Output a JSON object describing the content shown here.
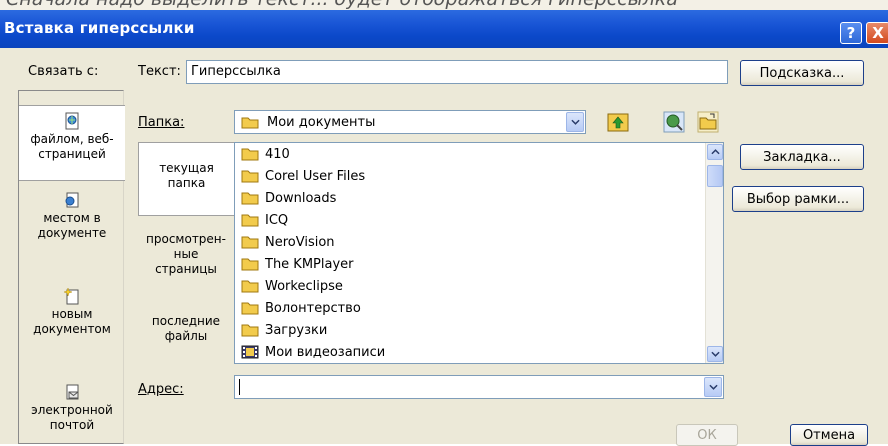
{
  "background_caption": "Сначала надо выделить текст... будет отображаться гиперссылка",
  "window": {
    "title": "Вставка гиперссылки",
    "help_label": "?",
    "close_label": "X"
  },
  "link_to": {
    "label": "Связать с:",
    "items": [
      {
        "label": "файлом, веб-страницей",
        "icon": "web-page-icon",
        "selected": true
      },
      {
        "label": "местом в документе",
        "icon": "place-in-document-icon",
        "selected": false
      },
      {
        "label": "новым документом",
        "icon": "new-document-icon",
        "selected": false
      },
      {
        "label": "электронной почтой",
        "icon": "email-icon",
        "selected": false
      }
    ]
  },
  "text_field": {
    "label": "Текст:",
    "value": "Гиперссылка"
  },
  "tooltip_button": "Подсказка...",
  "folder": {
    "label": "Папка:",
    "value": "Мои документы"
  },
  "places": [
    {
      "label": "текущая папка",
      "selected": true
    },
    {
      "label": "просмотрен-ные страницы",
      "selected": false
    },
    {
      "label": "последние файлы",
      "selected": false
    }
  ],
  "files": [
    {
      "name": "410",
      "icon": "folder-icon"
    },
    {
      "name": "Corel User Files",
      "icon": "folder-icon"
    },
    {
      "name": "Downloads",
      "icon": "folder-icon"
    },
    {
      "name": "ICQ",
      "icon": "folder-icon"
    },
    {
      "name": "NeroVision",
      "icon": "folder-icon"
    },
    {
      "name": "The KMPlayer",
      "icon": "folder-icon"
    },
    {
      "name": "Workeclipse",
      "icon": "folder-icon"
    },
    {
      "name": "Волонтерство",
      "icon": "folder-icon"
    },
    {
      "name": "Загрузки",
      "icon": "folder-icon"
    },
    {
      "name": "Мои видеозаписи",
      "icon": "video-folder-icon"
    }
  ],
  "bookmark_button": "Закладка...",
  "frame_button": "Выбор рамки...",
  "address": {
    "label": "Адрес:",
    "value": ""
  },
  "ok_button": "ОК",
  "cancel_button": "Отмена",
  "colors": {
    "titlebar": "#0a44bd",
    "dialog_bg": "#ece9d8",
    "field_border": "#7f9db9",
    "folder_yellow": "#f2cb4c"
  }
}
